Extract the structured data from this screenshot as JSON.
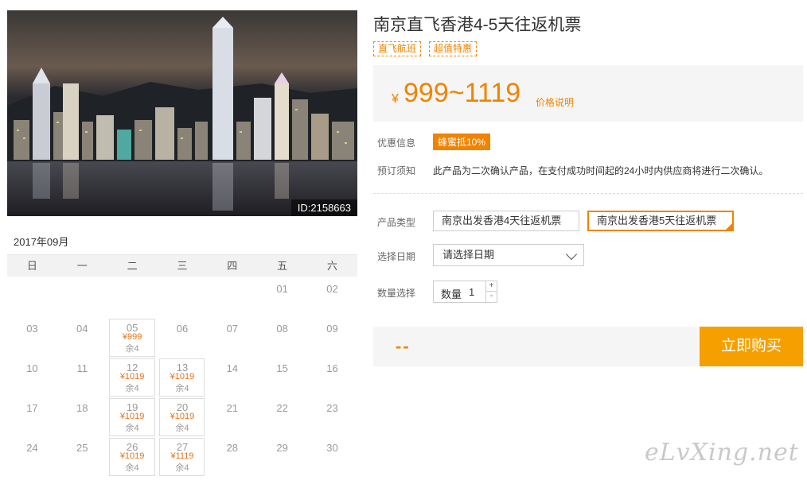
{
  "hero": {
    "image_id": "ID:2158663"
  },
  "calendar": {
    "month_label": "2017年09月",
    "weekdays": [
      "日",
      "一",
      "二",
      "三",
      "四",
      "五",
      "六"
    ],
    "weeks": [
      [
        null,
        null,
        null,
        null,
        null,
        {
          "day": "01"
        },
        {
          "day": "02"
        }
      ],
      [
        {
          "day": "03"
        },
        {
          "day": "04"
        },
        {
          "day": "05",
          "price": "¥999",
          "stock": "余4"
        },
        {
          "day": "06"
        },
        {
          "day": "07"
        },
        {
          "day": "08"
        },
        {
          "day": "09"
        }
      ],
      [
        {
          "day": "10"
        },
        {
          "day": "11"
        },
        {
          "day": "12",
          "price": "¥1019",
          "stock": "余4"
        },
        {
          "day": "13",
          "price": "¥1019",
          "stock": "余4"
        },
        {
          "day": "14"
        },
        {
          "day": "15"
        },
        {
          "day": "16"
        }
      ],
      [
        {
          "day": "17"
        },
        {
          "day": "18"
        },
        {
          "day": "19",
          "price": "¥1019",
          "stock": "余4"
        },
        {
          "day": "20",
          "price": "¥1019",
          "stock": "余4"
        },
        {
          "day": "21"
        },
        {
          "day": "22"
        },
        {
          "day": "23"
        }
      ],
      [
        {
          "day": "24"
        },
        {
          "day": "25"
        },
        {
          "day": "26",
          "price": "¥1019",
          "stock": "余4"
        },
        {
          "day": "27",
          "price": "¥1119",
          "stock": "余4"
        },
        {
          "day": "28"
        },
        {
          "day": "29"
        },
        {
          "day": "30"
        }
      ]
    ]
  },
  "product": {
    "title": "南京直飞香港4-5天往返机票",
    "tags": [
      "直飞航班",
      "超值特惠"
    ],
    "price_currency": "¥",
    "price_range": "999~1119",
    "price_note": "价格说明",
    "promo_label": "优惠信息",
    "promo_badge": "蜂蜜抵10%",
    "notice_label": "预订须知",
    "notice_text": "此产品为二次确认产品，在支付成功时间起的24小时内供应商将进行二次确认。",
    "type_label": "产品类型",
    "type_options": [
      "南京出发香港4天往返机票",
      "南京出发香港5天往返机票"
    ],
    "date_label": "选择日期",
    "date_placeholder": "请选择日期",
    "qty_label": "数量选择",
    "qty_inner_label": "数量",
    "qty_value": "1",
    "qty_plus": "+",
    "qty_minus": "-",
    "total": "--",
    "buy_label": "立即购买"
  },
  "watermark": "eLvXing.net",
  "colors": {
    "accent": "#f08300",
    "buy_button": "#f5a000"
  }
}
